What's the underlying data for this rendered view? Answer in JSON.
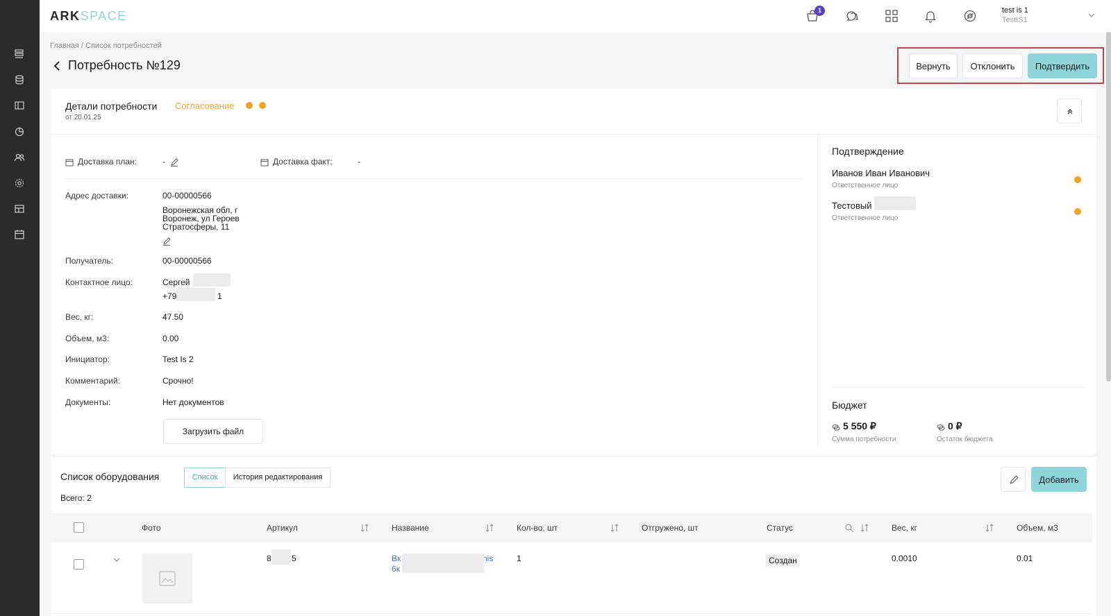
{
  "app": {
    "logo_ark": "ARK",
    "logo_space": "SPACE"
  },
  "header": {
    "cart_count": "1",
    "user_name": "test is 1",
    "user_org": "TestIS1"
  },
  "breadcrumb": "Главная / Список потребностей",
  "page": {
    "title": "Потребность №129"
  },
  "actions": {
    "return_label": "Вернуть",
    "reject_label": "Отклонить",
    "confirm_label": "Подтвердить"
  },
  "details": {
    "title": "Детали потребности",
    "date": "от 20.01.25",
    "status": "Согласование",
    "delivery_plan_label": "Доставка план:",
    "delivery_plan_value": "-",
    "delivery_fact_label": "Доставка факт:",
    "delivery_fact_value": "-",
    "address_label": "Адрес доставки:",
    "address_code": "00-00000566",
    "address_line1": "Воронежская обл, г",
    "address_line2": "Воронеж, ул Героев",
    "address_line3": "Стратосферы, 11",
    "recipient_label": "Получатель:",
    "recipient_value": "00-00000566",
    "contact_label": "Контактное лицо:",
    "contact_name": "Сергей",
    "contact_phone_start": "+79",
    "contact_phone_end": "1",
    "weight_label": "Вес, кг:",
    "weight_value": "47.50",
    "volume_label": "Объем, м3:",
    "volume_value": "0.00",
    "initiator_label": "Инициатор:",
    "initiator_value": "Test Is 2",
    "comment_label": "Комментарий:",
    "comment_value": "Срочно!",
    "documents_label": "Документы:",
    "documents_value": "Нет документов",
    "upload_label": "Загрузить файл"
  },
  "confirmation": {
    "title": "Подтверждение",
    "people": [
      {
        "name": "Иванов Иван Иванович",
        "role": "Ответственное лицо",
        "status_color": "#f2a220"
      },
      {
        "name": "Тестовый",
        "role": "Ответственное лицо",
        "status_color": "#f2a220"
      }
    ]
  },
  "budget": {
    "title": "Бюджет",
    "sum_value": "5 550 ₽",
    "sum_label": "Сумма потребности",
    "rest_value": "0 ₽",
    "rest_label": "Остаток бюджета"
  },
  "equipment": {
    "title": "Список оборудования",
    "tabs": [
      {
        "label": "Список"
      },
      {
        "label": "История редактирования"
      }
    ],
    "total": "Всего: 2",
    "add_label": "Добавить",
    "columns": [
      "Фото",
      "Артикул",
      "Название",
      "Кол-во, шт",
      "Отгружено, шт",
      "Статус",
      "Вес, кг",
      "Объем, м3"
    ],
    "rows": [
      {
        "article_start": "8",
        "article_end": "5",
        "name_line1_start": "Вк",
        "name_line1_end": "nis",
        "name_line2": "6к",
        "qty": "1",
        "status": "Создан",
        "weight": "0.0010",
        "volume": "0.01"
      }
    ]
  },
  "colors": {
    "accent": "#8fd4da",
    "status_orange": "#f2a220",
    "link": "#3a7bc8",
    "highlight": "#c8414b"
  }
}
